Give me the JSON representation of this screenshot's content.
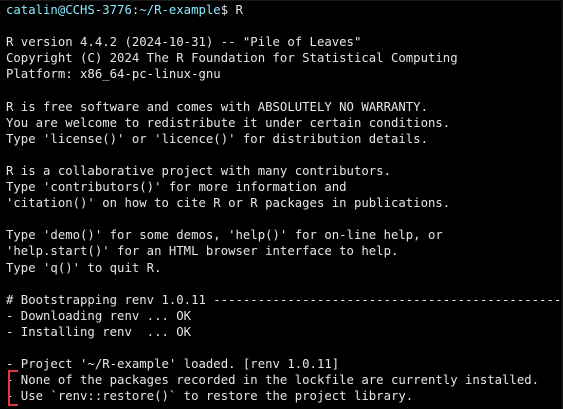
{
  "prompt": {
    "user_host": "catalin@CCHS-3776",
    "sep": ":",
    "path": "~/R-example",
    "suffix": "$ R"
  },
  "lines": [
    "",
    "R version 4.4.2 (2024-10-31) -- \"Pile of Leaves\"",
    "Copyright (C) 2024 The R Foundation for Statistical Computing",
    "Platform: x86_64-pc-linux-gnu",
    "",
    "R is free software and comes with ABSOLUTELY NO WARRANTY.",
    "You are welcome to redistribute it under certain conditions.",
    "Type 'license()' or 'licence()' for distribution details.",
    "",
    "R is a collaborative project with many contributors.",
    "Type 'contributors()' for more information and",
    "'citation()' on how to cite R or R packages in publications.",
    "",
    "Type 'demo()' for some demos, 'help()' for on-line help, or",
    "'help.start()' for an HTML browser interface to help.",
    "Type 'q()' to quit R.",
    "",
    "# Bootstrapping renv 1.0.11 -----------------------------------------------",
    "- Downloading renv ... OK",
    "- Installing renv  ... OK",
    "",
    "- Project '~/R-example' loaded. [renv 1.0.11]",
    "- None of the packages recorded in the lockfile are currently installed.",
    "- Use `renv::restore()` to restore the project library."
  ],
  "colors": {
    "background": "#000000",
    "text": "#e6e6e6",
    "prompt": "#8be9fd",
    "marker": "#e53935"
  }
}
